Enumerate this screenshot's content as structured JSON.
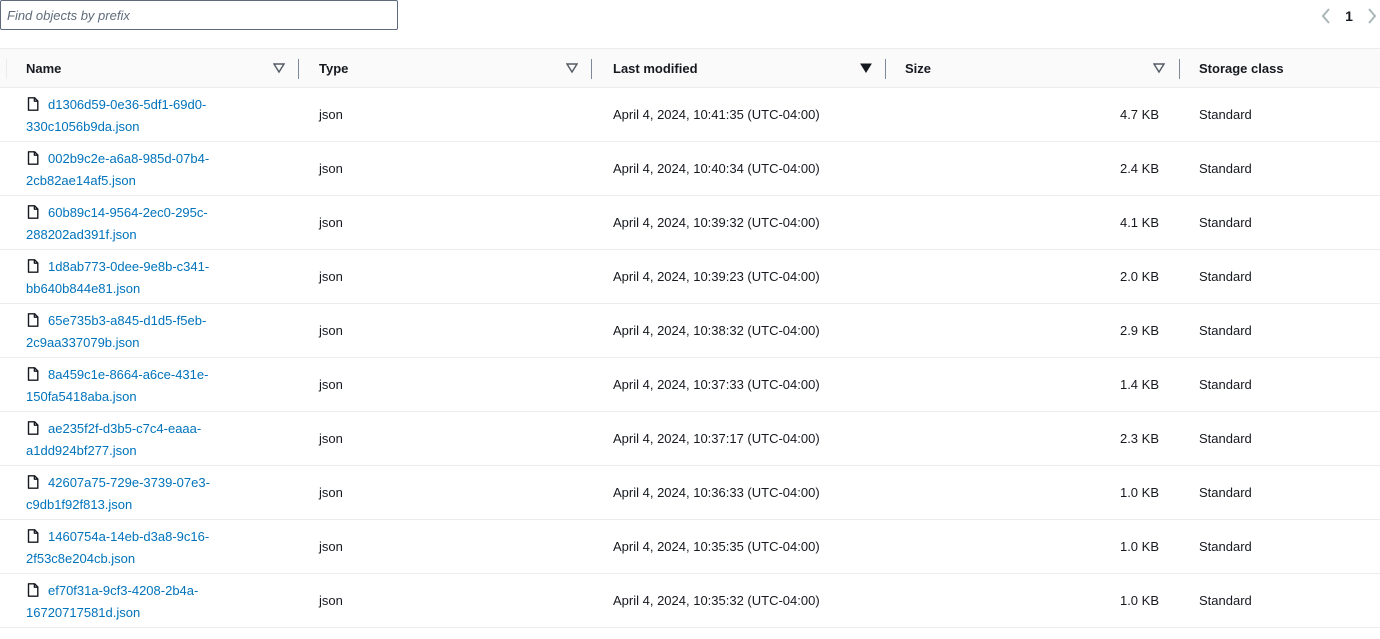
{
  "search": {
    "placeholder": "Find objects by prefix",
    "value": ""
  },
  "pagination": {
    "current_page": "1"
  },
  "columns": {
    "name": "Name",
    "type": "Type",
    "last_modified": "Last modified",
    "size": "Size",
    "storage_class": "Storage class"
  },
  "rows": [
    {
      "name_line1": "d1306d59-0e36-5df1-69d0-",
      "name_line2": "330c1056b9da.json",
      "type": "json",
      "last_modified": "April 4, 2024, 10:41:35 (UTC-04:00)",
      "size": "4.7 KB",
      "storage_class": "Standard"
    },
    {
      "name_line1": "002b9c2e-a6a8-985d-07b4-",
      "name_line2": "2cb82ae14af5.json",
      "type": "json",
      "last_modified": "April 4, 2024, 10:40:34 (UTC-04:00)",
      "size": "2.4 KB",
      "storage_class": "Standard"
    },
    {
      "name_line1": "60b89c14-9564-2ec0-295c-",
      "name_line2": "288202ad391f.json",
      "type": "json",
      "last_modified": "April 4, 2024, 10:39:32 (UTC-04:00)",
      "size": "4.1 KB",
      "storage_class": "Standard"
    },
    {
      "name_line1": "1d8ab773-0dee-9e8b-c341-",
      "name_line2": "bb640b844e81.json",
      "type": "json",
      "last_modified": "April 4, 2024, 10:39:23 (UTC-04:00)",
      "size": "2.0 KB",
      "storage_class": "Standard"
    },
    {
      "name_line1": "65e735b3-a845-d1d5-f5eb-",
      "name_line2": "2c9aa337079b.json",
      "type": "json",
      "last_modified": "April 4, 2024, 10:38:32 (UTC-04:00)",
      "size": "2.9 KB",
      "storage_class": "Standard"
    },
    {
      "name_line1": "8a459c1e-8664-a6ce-431e-",
      "name_line2": "150fa5418aba.json",
      "type": "json",
      "last_modified": "April 4, 2024, 10:37:33 (UTC-04:00)",
      "size": "1.4 KB",
      "storage_class": "Standard"
    },
    {
      "name_line1": "ae235f2f-d3b5-c7c4-eaaa-",
      "name_line2": "a1dd924bf277.json",
      "type": "json",
      "last_modified": "April 4, 2024, 10:37:17 (UTC-04:00)",
      "size": "2.3 KB",
      "storage_class": "Standard"
    },
    {
      "name_line1": "42607a75-729e-3739-07e3-",
      "name_line2": "c9db1f92f813.json",
      "type": "json",
      "last_modified": "April 4, 2024, 10:36:33 (UTC-04:00)",
      "size": "1.0 KB",
      "storage_class": "Standard"
    },
    {
      "name_line1": "1460754a-14eb-d3a8-9c16-",
      "name_line2": "2f53c8e204cb.json",
      "type": "json",
      "last_modified": "April 4, 2024, 10:35:35 (UTC-04:00)",
      "size": "1.0 KB",
      "storage_class": "Standard"
    },
    {
      "name_line1": "ef70f31a-9cf3-4208-2b4a-",
      "name_line2": "16720717581d.json",
      "type": "json",
      "last_modified": "April 4, 2024, 10:35:32 (UTC-04:00)",
      "size": "1.0 KB",
      "storage_class": "Standard"
    }
  ],
  "icons": {
    "file": "file-icon",
    "sort": "caret-down-icon",
    "prev": "chevron-left-icon",
    "next": "chevron-right-icon"
  },
  "colors": {
    "link": "#0073bb",
    "text": "#16191f",
    "border": "#eaeded"
  }
}
